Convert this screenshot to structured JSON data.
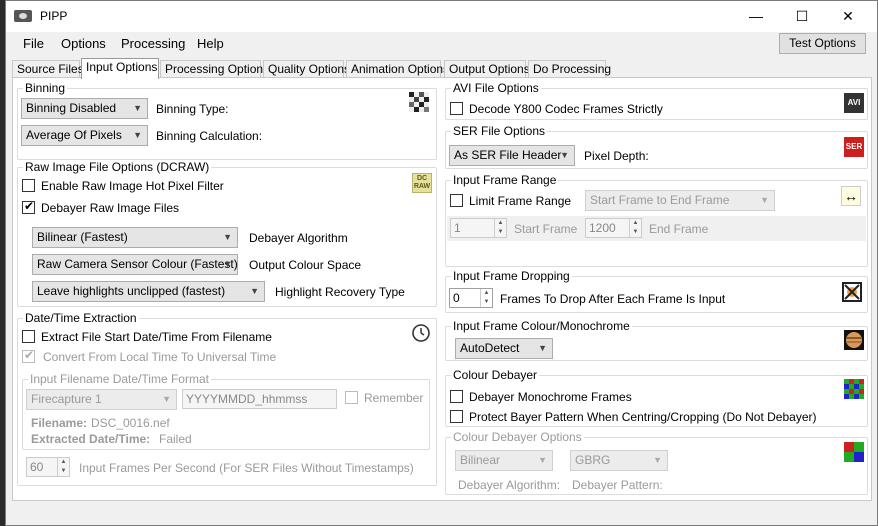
{
  "window": {
    "title": "PIPP"
  },
  "menubar": {
    "file": "File",
    "options": "Options",
    "processing": "Processing",
    "help": "Help",
    "test_options": "Test Options"
  },
  "tabs": [
    "Source Files",
    "Input Options",
    "Processing Options",
    "Quality Options",
    "Animation Options",
    "Output Options",
    "Do Processing"
  ],
  "binning": {
    "title": "Binning",
    "type_value": "Binning Disabled",
    "type_label": "Binning Type:",
    "calc_value": "Average Of Pixels",
    "calc_label": "Binning Calculation:"
  },
  "raw": {
    "title": "Raw Image File Options (DCRAW)",
    "hot_pixel": "Enable Raw Image Hot Pixel Filter",
    "debayer": "Debayer Raw Image Files",
    "algorithm_value": "Bilinear (Fastest)",
    "algorithm_label": "Debayer Algorithm",
    "colour_value": "Raw Camera Sensor Colour (Fastest)",
    "colour_label": "Output Colour Space",
    "highlight_value": "Leave highlights unclipped (fastest)",
    "highlight_label": "Highlight Recovery Type"
  },
  "datetime": {
    "title": "Date/Time Extraction",
    "extract": "Extract File Start Date/Time From Filename",
    "convert": "Convert From Local Time To Universal Time",
    "fmt_title": "Input Filename Date/Time Format",
    "fmt_value": "Firecapture 1",
    "fmt_pattern": "YYYYMMDD_hhmmss",
    "remember": "Remember",
    "filename_label": "Filename:",
    "filename_value": "DSC_0016.nef",
    "extracted_label": "Extracted Date/Time:",
    "extracted_value": "Failed",
    "fps_value": "60",
    "fps_label": "Input Frames Per Second (For SER Files Without Timestamps)"
  },
  "avi": {
    "title": "AVI File Options",
    "y800": "Decode Y800 Codec Frames Strictly"
  },
  "ser": {
    "title": "SER File Options",
    "depth_value": "As SER File Header",
    "depth_label": "Pixel Depth:"
  },
  "range": {
    "title": "Input Frame Range",
    "limit": "Limit Frame Range",
    "mode_value": "Start Frame to End Frame",
    "start_value": "1",
    "start_label": "Start Frame",
    "end_value": "1200",
    "end_label": "End Frame"
  },
  "dropping": {
    "title": "Input Frame Dropping",
    "value": "0",
    "label": "Frames To Drop After Each Frame Is Input"
  },
  "mono": {
    "title": "Input Frame Colour/Monochrome",
    "value": "AutoDetect"
  },
  "colour_debayer": {
    "title": "Colour Debayer",
    "mono_frames": "Debayer Monochrome Frames",
    "protect": "Protect Bayer Pattern When Centring/Cropping (Do Not Debayer)"
  },
  "debayer_opts": {
    "title": "Colour Debayer Options",
    "algorithm_value": "Bilinear",
    "pattern_value": "GBRG",
    "algorithm_label": "Debayer Algorithm:",
    "pattern_label": "Debayer Pattern:"
  },
  "icons": {
    "avi_text": "AVI",
    "ser_text": "SER",
    "dcraw_text": "DC RAW"
  },
  "colors": {
    "ser_icon": "#cc1f1f",
    "avi_icon": "#333333"
  }
}
